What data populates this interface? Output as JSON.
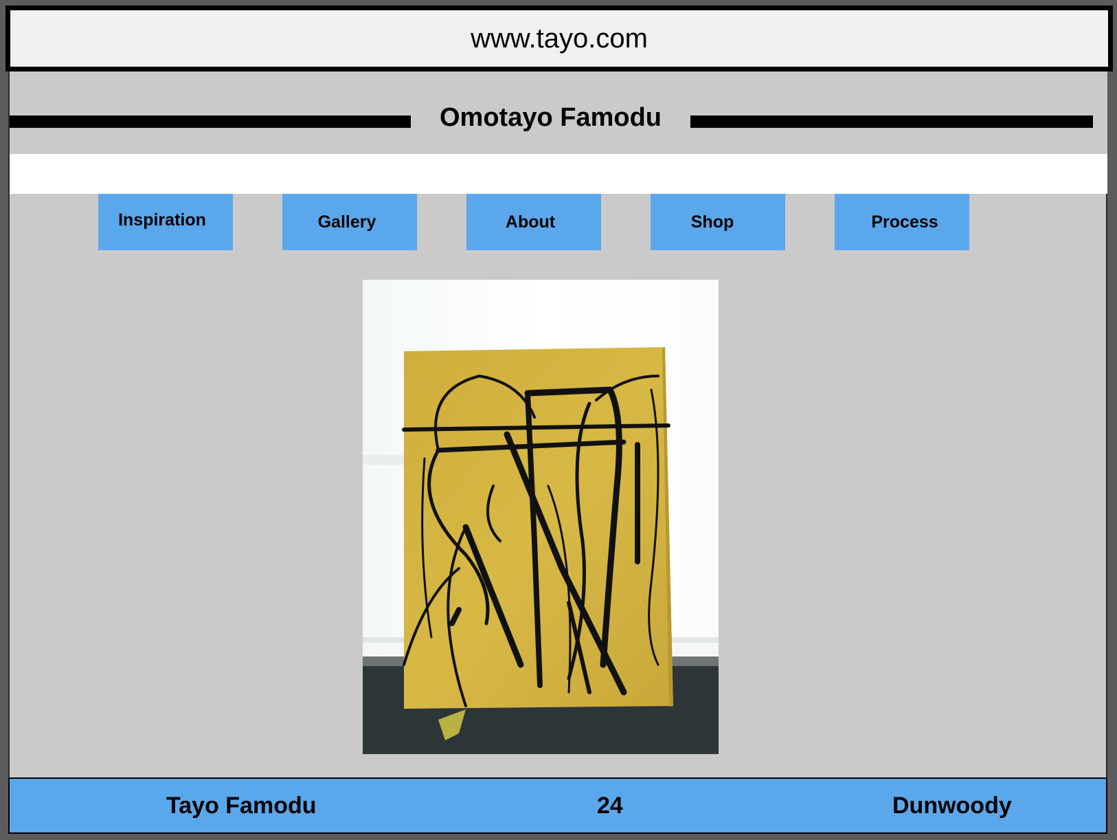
{
  "browser": {
    "url": "www.tayo.com"
  },
  "header": {
    "site_title": "Omotayo Famodu"
  },
  "nav": {
    "items": [
      {
        "label": "Inspiration"
      },
      {
        "label": "Gallery"
      },
      {
        "label": "About"
      },
      {
        "label": "Shop"
      },
      {
        "label": "Process"
      }
    ]
  },
  "main": {
    "image": {
      "subject": "abstract painting: black brush strokes on yellow canvas on a windowsill"
    }
  },
  "footer": {
    "name": "Tayo Famodu",
    "number": "24",
    "location": "Dunwoody"
  },
  "colors": {
    "page_background": "#cacaca",
    "nav_button": "#5ba7ec",
    "footer": "#5ba7ec",
    "painting_yellow": "#d4b43c"
  }
}
